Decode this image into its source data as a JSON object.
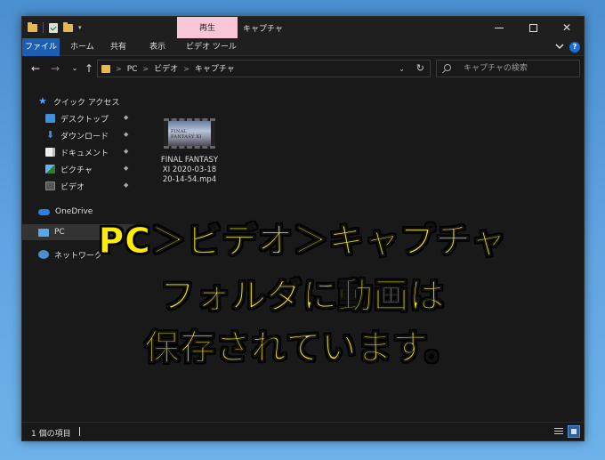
{
  "window": {
    "title": "キャプチャ",
    "context_tab": "再生",
    "minimize": "—",
    "close": "✕"
  },
  "ribbon": {
    "tabs": [
      "ファイル",
      "ホーム",
      "共有",
      "表示",
      "ビデオ ツール"
    ],
    "help": "?"
  },
  "nav": {
    "back": "←",
    "forward": "→",
    "recent": "⌄",
    "up": "↑",
    "breadcrumb": [
      "PC",
      "ビデオ",
      "キャプチャ"
    ],
    "breadcrumb_sep": ">",
    "refresh": "↻",
    "search_placeholder": "キャプチャの検索"
  },
  "sidebar": {
    "items": [
      {
        "label": "クイック アクセス",
        "icon": "star-icon"
      },
      {
        "label": "デスクトップ",
        "icon": "desktop-icon",
        "pinned": true
      },
      {
        "label": "ダウンロード",
        "icon": "download-icon",
        "pinned": true
      },
      {
        "label": "ドキュメント",
        "icon": "document-icon",
        "pinned": true
      },
      {
        "label": "ピクチャ",
        "icon": "pictures-icon",
        "pinned": true
      },
      {
        "label": "ビデオ",
        "icon": "videos-icon",
        "pinned": true
      },
      {
        "label": "OneDrive",
        "icon": "onedrive-icon"
      },
      {
        "label": "PC",
        "icon": "pc-icon",
        "selected": true
      },
      {
        "label": "ネットワーク",
        "icon": "network-icon"
      }
    ],
    "pin_glyph": "📌"
  },
  "content": {
    "files": [
      {
        "name": "FINAL FANTASY\nXI 2020-03-18\n20-14-54.mp4",
        "thumb_text": "FINAL FANTASY XI"
      }
    ]
  },
  "status": {
    "item_count": "1 個の項目"
  },
  "caption": {
    "line1": "PC＞ビデオ＞キャプチャ",
    "line2": "フォルダに動画は",
    "line3": "保存されています。"
  },
  "colors": {
    "accent": "#1a5fb4",
    "caption": "#ffee00",
    "context_tab": "#f9c6d8"
  }
}
